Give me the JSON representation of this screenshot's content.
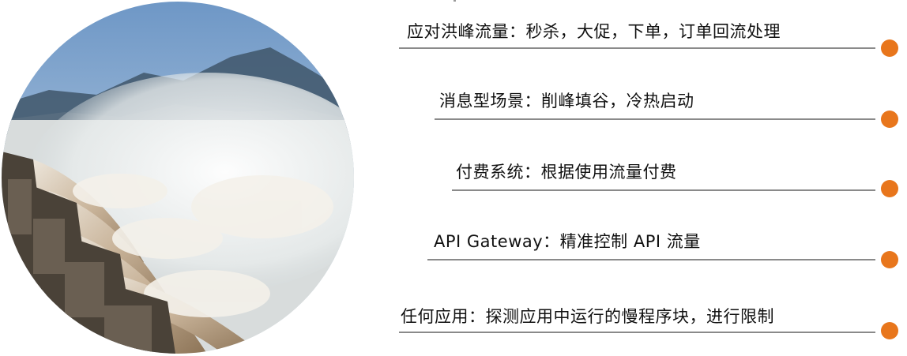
{
  "image": {
    "subject": "dam-floodgate-spillway-photo"
  },
  "colors": {
    "accent": "#e8761c",
    "line": "#8a8a8a",
    "text": "#111111"
  },
  "items": [
    {
      "label": "应对洪峰流量：秒杀，大促，下单，订单回流处理"
    },
    {
      "label": "消息型场景：削峰填谷，冷热启动"
    },
    {
      "label": "付费系统：根据使用流量付费"
    },
    {
      "label": "API Gateway：精准控制 API 流量"
    },
    {
      "label": "任何应用：探测应用中运行的慢程序块，进行限制"
    }
  ]
}
